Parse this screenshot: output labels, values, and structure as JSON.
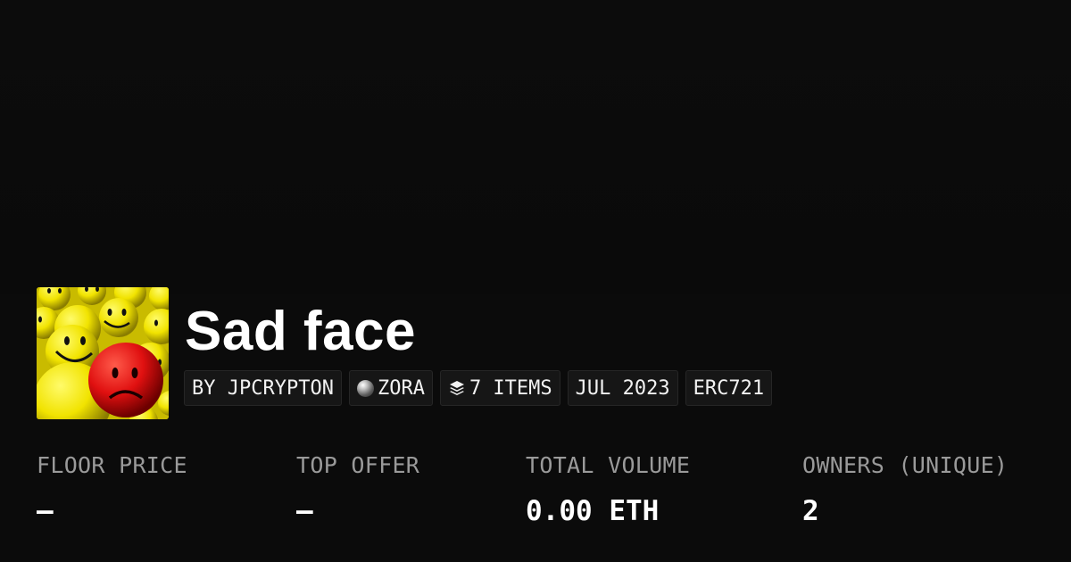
{
  "collection": {
    "title": "Sad face",
    "thumbnail_icon": "sad-smiley-image"
  },
  "tags": {
    "creator": "BY JPCRYPTON",
    "chain": "ZORA",
    "items": "7 ITEMS",
    "date": "JUL 2023",
    "standard": "ERC721"
  },
  "stats": {
    "floor_price": {
      "label": "FLOOR PRICE",
      "value": "–"
    },
    "top_offer": {
      "label": "TOP OFFER",
      "value": "–"
    },
    "total_volume": {
      "label": "TOTAL VOLUME",
      "value": "0.00 ETH"
    },
    "owners": {
      "label": "OWNERS (UNIQUE)",
      "value": "2"
    }
  },
  "colors": {
    "background": "#0b0b0b",
    "tag_background": "#161616",
    "label": "#9a9a9a",
    "value": "#ffffff"
  }
}
